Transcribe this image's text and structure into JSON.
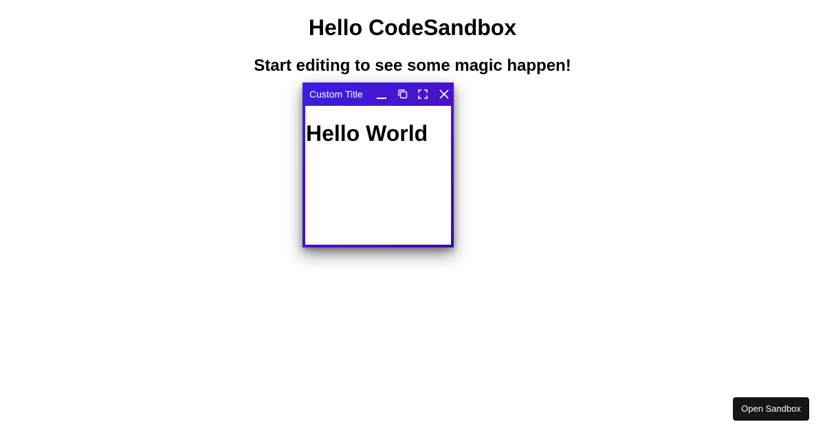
{
  "page": {
    "title": "Hello CodeSandbox",
    "subtitle": "Start editing to see some magic happen!"
  },
  "window": {
    "title": "Custom Title",
    "content_heading": "Hello World",
    "controls": [
      "minimize-icon",
      "restore-icon",
      "maximize-icon",
      "close-icon"
    ],
    "gradient_colors": [
      "#3a1fe0",
      "#4a10c8",
      "#3b0aa6"
    ]
  },
  "footer": {
    "open_sandbox_label": "Open Sandbox"
  }
}
